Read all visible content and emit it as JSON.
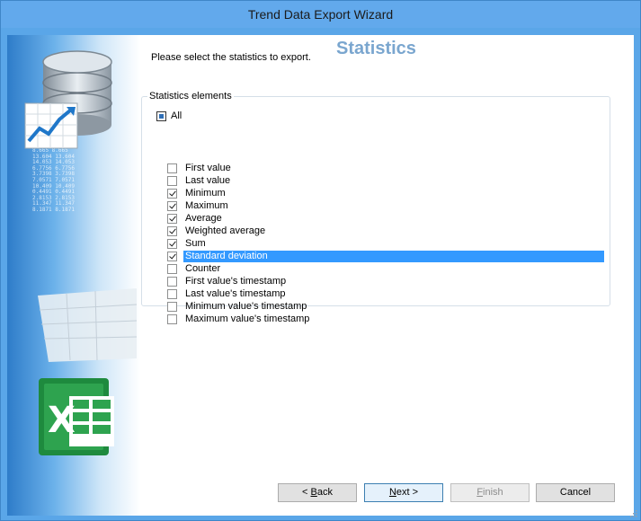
{
  "window": {
    "title": "Trend Data Export Wizard"
  },
  "page": {
    "title": "Statistics",
    "instruction": "Please select the statistics to export.",
    "group_label": "Statistics elements"
  },
  "tree": {
    "root": {
      "label": "All",
      "state": "partial"
    },
    "items": [
      {
        "label": "First value",
        "checked": false
      },
      {
        "label": "Last value",
        "checked": false
      },
      {
        "label": "Minimum",
        "checked": true
      },
      {
        "label": "Maximum",
        "checked": true
      },
      {
        "label": "Average",
        "checked": true
      },
      {
        "label": "Weighted average",
        "checked": true
      },
      {
        "label": "Sum",
        "checked": true
      },
      {
        "label": "Standard deviation",
        "checked": true,
        "selected": true
      },
      {
        "label": "Counter",
        "checked": false
      },
      {
        "label": "First value's timestamp",
        "checked": false
      },
      {
        "label": "Last value's timestamp",
        "checked": false
      },
      {
        "label": "Minimum value's timestamp",
        "checked": false
      },
      {
        "label": "Maximum value's timestamp",
        "checked": false
      }
    ]
  },
  "buttons": {
    "back": {
      "pre": "< ",
      "mnemonic": "B",
      "post": "ack"
    },
    "next": {
      "pre": "",
      "mnemonic": "N",
      "post": "ext >"
    },
    "finish": {
      "pre": "",
      "mnemonic": "F",
      "post": "inish"
    },
    "cancel": {
      "label": "Cancel"
    }
  },
  "colors": {
    "accent": "#62a9ec",
    "selection": "#3399ff",
    "title": "#7aa6cf"
  },
  "icons": [
    "database-icon",
    "chart-icon",
    "spreadsheet-icon",
    "excel-icon",
    "resize-grip-icon"
  ]
}
